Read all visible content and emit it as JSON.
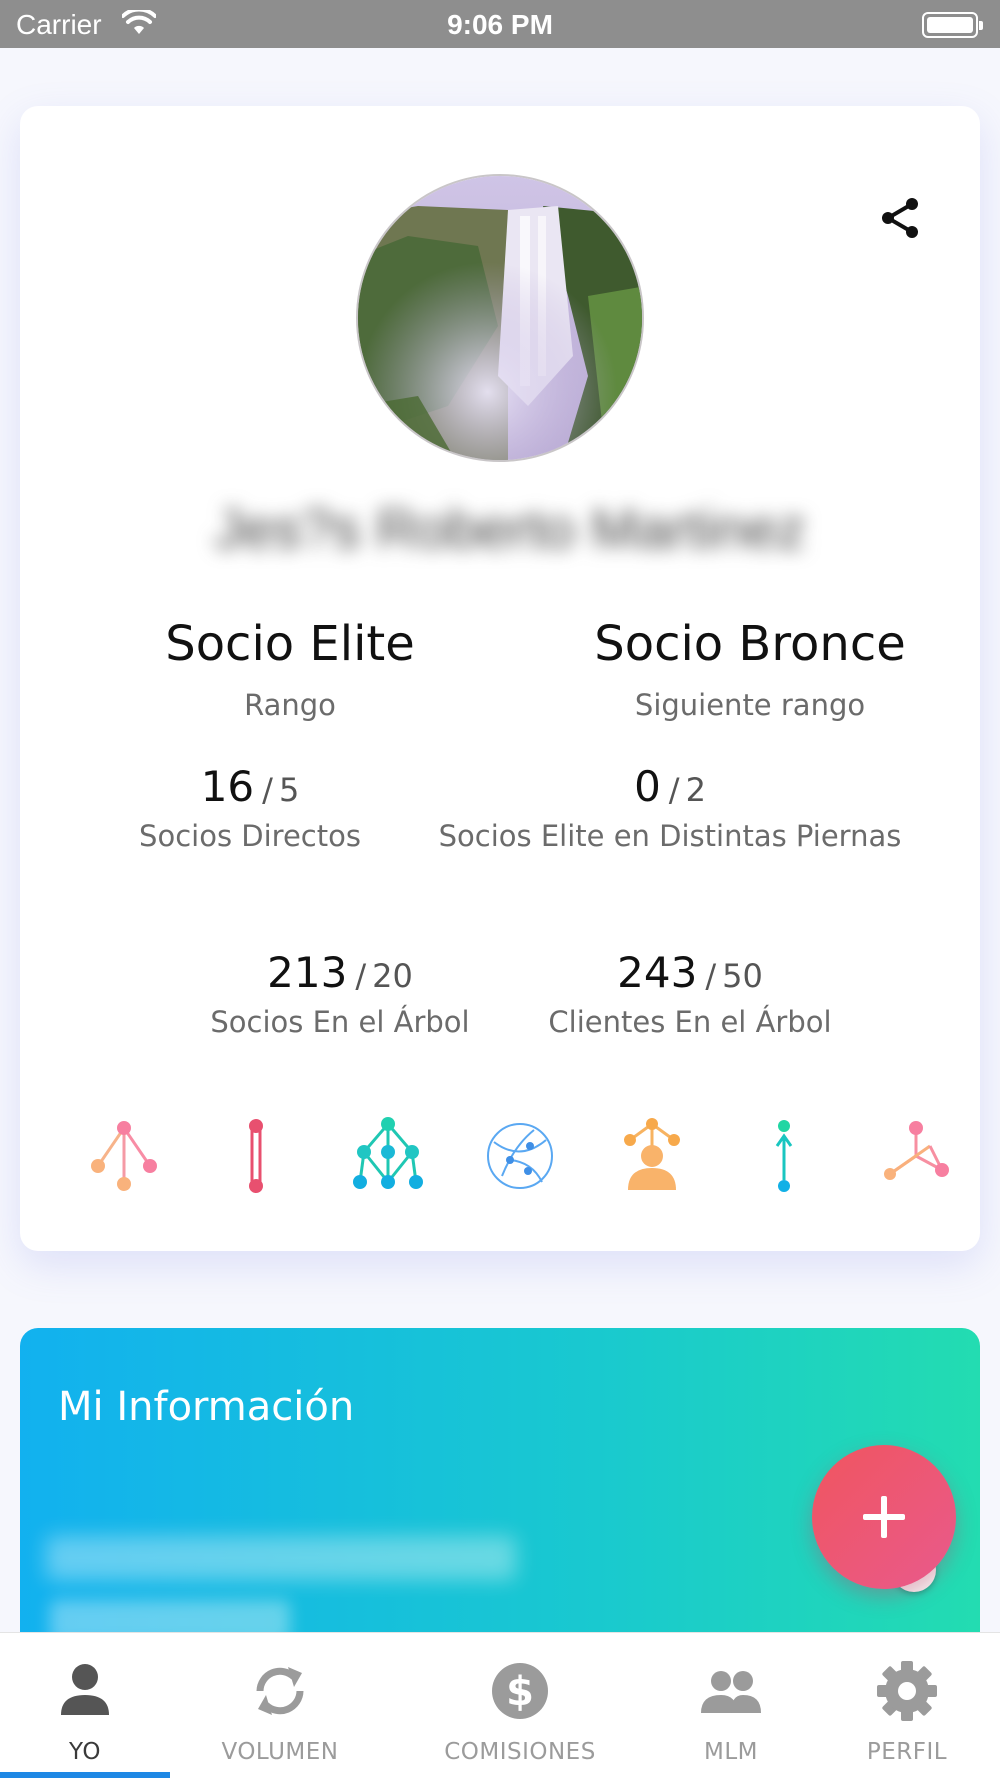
{
  "status_bar": {
    "carrier": "Carrier",
    "time": "9:06 PM"
  },
  "profile": {
    "name": "Jes?s Roberto Martinez",
    "rank": {
      "value": "Socio Elite",
      "label": "Rango"
    },
    "next_rank": {
      "value": "Socio Bronce",
      "label": "Siguiente rango"
    },
    "stats": [
      {
        "current": "16",
        "goal": "5",
        "label": "Socios Directos"
      },
      {
        "current": "0",
        "goal": "2",
        "label": "Socios Elite en Distintas Piernas"
      },
      {
        "current": "213",
        "goal": "20",
        "label": "Socios En el Árbol"
      },
      {
        "current": "243",
        "goal": "50",
        "label": "Clientes En el Árbol"
      }
    ],
    "slash": "/",
    "icons": [
      "tree-icon",
      "vertical-line-icon",
      "network-icon",
      "globe-network-icon",
      "sponsor-icon",
      "upline-icon",
      "binary-icon"
    ]
  },
  "info": {
    "title": "Mi Información",
    "name_blurred": "Jes?s Roberto Martinez"
  },
  "fab": {
    "label": "+"
  },
  "tabs": [
    {
      "label": "YO",
      "icon": "person-icon",
      "active": true
    },
    {
      "label": "VOLUMEN",
      "icon": "refresh-icon",
      "active": false
    },
    {
      "label": "COMISIONES",
      "icon": "dollar-icon",
      "active": false
    },
    {
      "label": "MLM",
      "icon": "group-icon",
      "active": false
    },
    {
      "label": "PERFIL",
      "icon": "gear-icon",
      "active": false
    }
  ],
  "colors": {
    "accent_blue": "#1e88e5",
    "fab_red": "#f0555f",
    "info_gradient_start": "#12b1ef",
    "info_gradient_end": "#23dcb1"
  }
}
